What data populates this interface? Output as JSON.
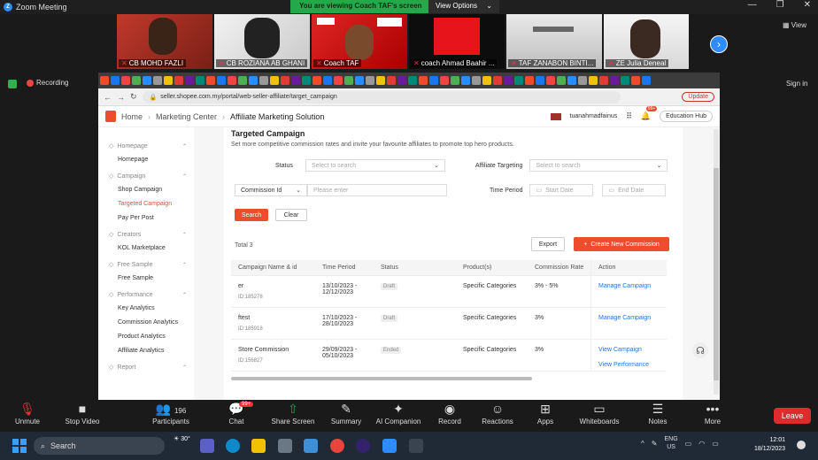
{
  "zoom": {
    "window_title": "Zoom Meeting",
    "viewing_banner": "You are viewing Coach TAF's screen",
    "view_options": "View Options",
    "view_button": "View",
    "recording": "Recording",
    "sign_in": "Sign in",
    "participants": [
      {
        "name": "CB MOHD FAZLI"
      },
      {
        "name": "CB ROZIANA AB GHANI"
      },
      {
        "name": "Coach TAF"
      },
      {
        "name": "coach Ahmad Baahir ..."
      },
      {
        "name": "TAF ZANABON BINTI..."
      },
      {
        "name": "ZE Julia Deneal"
      }
    ],
    "toolbar": {
      "unmute": "Unmute",
      "stop_video": "Stop Video",
      "participants": "Participants",
      "participants_count": "196",
      "chat": "Chat",
      "chat_badge": "99+",
      "share_screen": "Share Screen",
      "summary": "Summary",
      "ai_companion": "AI Companion",
      "record": "Record",
      "reactions": "Reactions",
      "apps": "Apps",
      "whiteboards": "Whiteboards",
      "notes": "Notes",
      "more": "More",
      "leave": "Leave"
    }
  },
  "browser": {
    "url": "seller.shopee.com.my/portal/web-seller-affiliate/target_campaign",
    "update": "Update"
  },
  "shopee": {
    "breadcrumb": [
      "Home",
      "Marketing Center",
      "Affiliate Marketing Solution"
    ],
    "username": "tuanahmadfainus",
    "bell_badge": "99+",
    "education_hub": "Education Hub",
    "sidebar": [
      {
        "head": "Homepage",
        "items": [
          {
            "label": "Homepage",
            "active": false
          }
        ]
      },
      {
        "head": "Campaign",
        "items": [
          {
            "label": "Shop Campaign",
            "active": false
          },
          {
            "label": "Targeted Campaign",
            "active": true
          },
          {
            "label": "Pay Per Post",
            "active": false
          }
        ]
      },
      {
        "head": "Creators",
        "items": [
          {
            "label": "KOL Marketplace",
            "active": false
          }
        ]
      },
      {
        "head": "Free Sample",
        "items": [
          {
            "label": "Free Sample",
            "active": false
          }
        ]
      },
      {
        "head": "Performance",
        "items": [
          {
            "label": "Key Analytics",
            "active": false
          },
          {
            "label": "Commission Analytics",
            "active": false
          },
          {
            "label": "Product Analytics",
            "active": false
          },
          {
            "label": "Affiliate Analytics",
            "active": false
          }
        ]
      },
      {
        "head": "Report",
        "items": []
      }
    ],
    "page_title": "Targeted Campaign",
    "page_subtitle": "Set more competitive commission rates and invite your favourite affiliates to promote top hero products.",
    "filters": {
      "status_label": "Status",
      "status_placeholder": "Select to search",
      "affiliate_label": "Affiliate Targeting",
      "affiliate_placeholder": "Select to search",
      "commission_select": "Commission Id",
      "commission_placeholder": "Please enter",
      "time_label": "Time Period",
      "start_date": "Start Date",
      "end_date": "End Date",
      "search": "Search",
      "clear": "Clear"
    },
    "total": "Total 3",
    "export": "Export",
    "create": "Create New Commission",
    "columns": [
      "Campaign Name & id",
      "Time Period",
      "Status",
      "Product(s)",
      "Commission Rate",
      "Action"
    ],
    "rows": [
      {
        "name": "er",
        "id": "ID:185278",
        "period_start": "13/10/2023 -",
        "period_end": "12/12/2023",
        "status": "Draft",
        "products": "Specific Categories",
        "rate": "3% - 5%",
        "actions": [
          "Manage Campaign"
        ]
      },
      {
        "name": "ftest",
        "id": "ID:185918",
        "period_start": "17/10/2023 -",
        "period_end": "28/10/2023",
        "status": "Draft",
        "products": "Specific Categories",
        "rate": "3%",
        "actions": [
          "Manage Campaign"
        ]
      },
      {
        "name": "Store Commission",
        "id": "ID:156827",
        "period_start": "29/09/2023 -",
        "period_end": "05/10/2023",
        "status": "Ended",
        "products": "Specific Categories",
        "rate": "3%",
        "actions": [
          "View Campaign",
          "View Performance"
        ]
      }
    ]
  },
  "taskbar": {
    "search": "Search",
    "temperature": "30°",
    "lang_line1": "ENG",
    "lang_line2": "US",
    "time": "12:01",
    "date": "18/12/2023"
  },
  "colors": {
    "shopee_orange": "#ee4d2d",
    "zoom_blue": "#2d8cff",
    "share_green": "#23a94a",
    "link_blue": "#2673dd"
  }
}
